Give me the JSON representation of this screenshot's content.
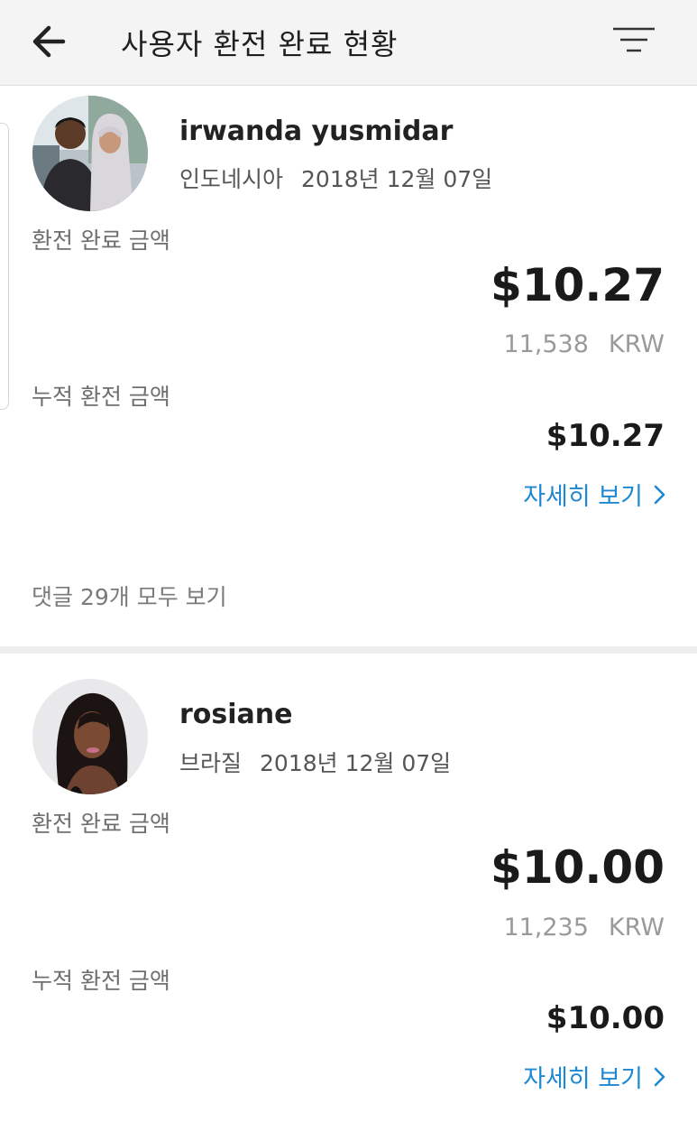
{
  "header": {
    "title": "사용자 환전 완료 현황",
    "back_icon": "arrow-left-icon",
    "filter_icon": "filter-lines-icon"
  },
  "labels": {
    "exchange_completed": "환전 완료 금액",
    "cumulative_exchange": "누적 환전 금액",
    "view_details": "자세히 보기"
  },
  "colors": {
    "link": "#1e88d2",
    "header_bg": "#f4f4f4",
    "muted_text": "#9a9a9a"
  },
  "entries": [
    {
      "name": "irwanda yusmidar",
      "country": "인도네시아",
      "date": "2018년 12월 07일",
      "amount_usd": "$10.27",
      "amount_krw": "11,538",
      "currency": "KRW",
      "cumulative_usd": "$10.27",
      "comments_link": "댓글 29개 모두 보기"
    },
    {
      "name": "rosiane",
      "country": "브라질",
      "date": "2018년 12월 07일",
      "amount_usd": "$10.00",
      "amount_krw": "11,235",
      "currency": "KRW",
      "cumulative_usd": "$10.00"
    }
  ]
}
